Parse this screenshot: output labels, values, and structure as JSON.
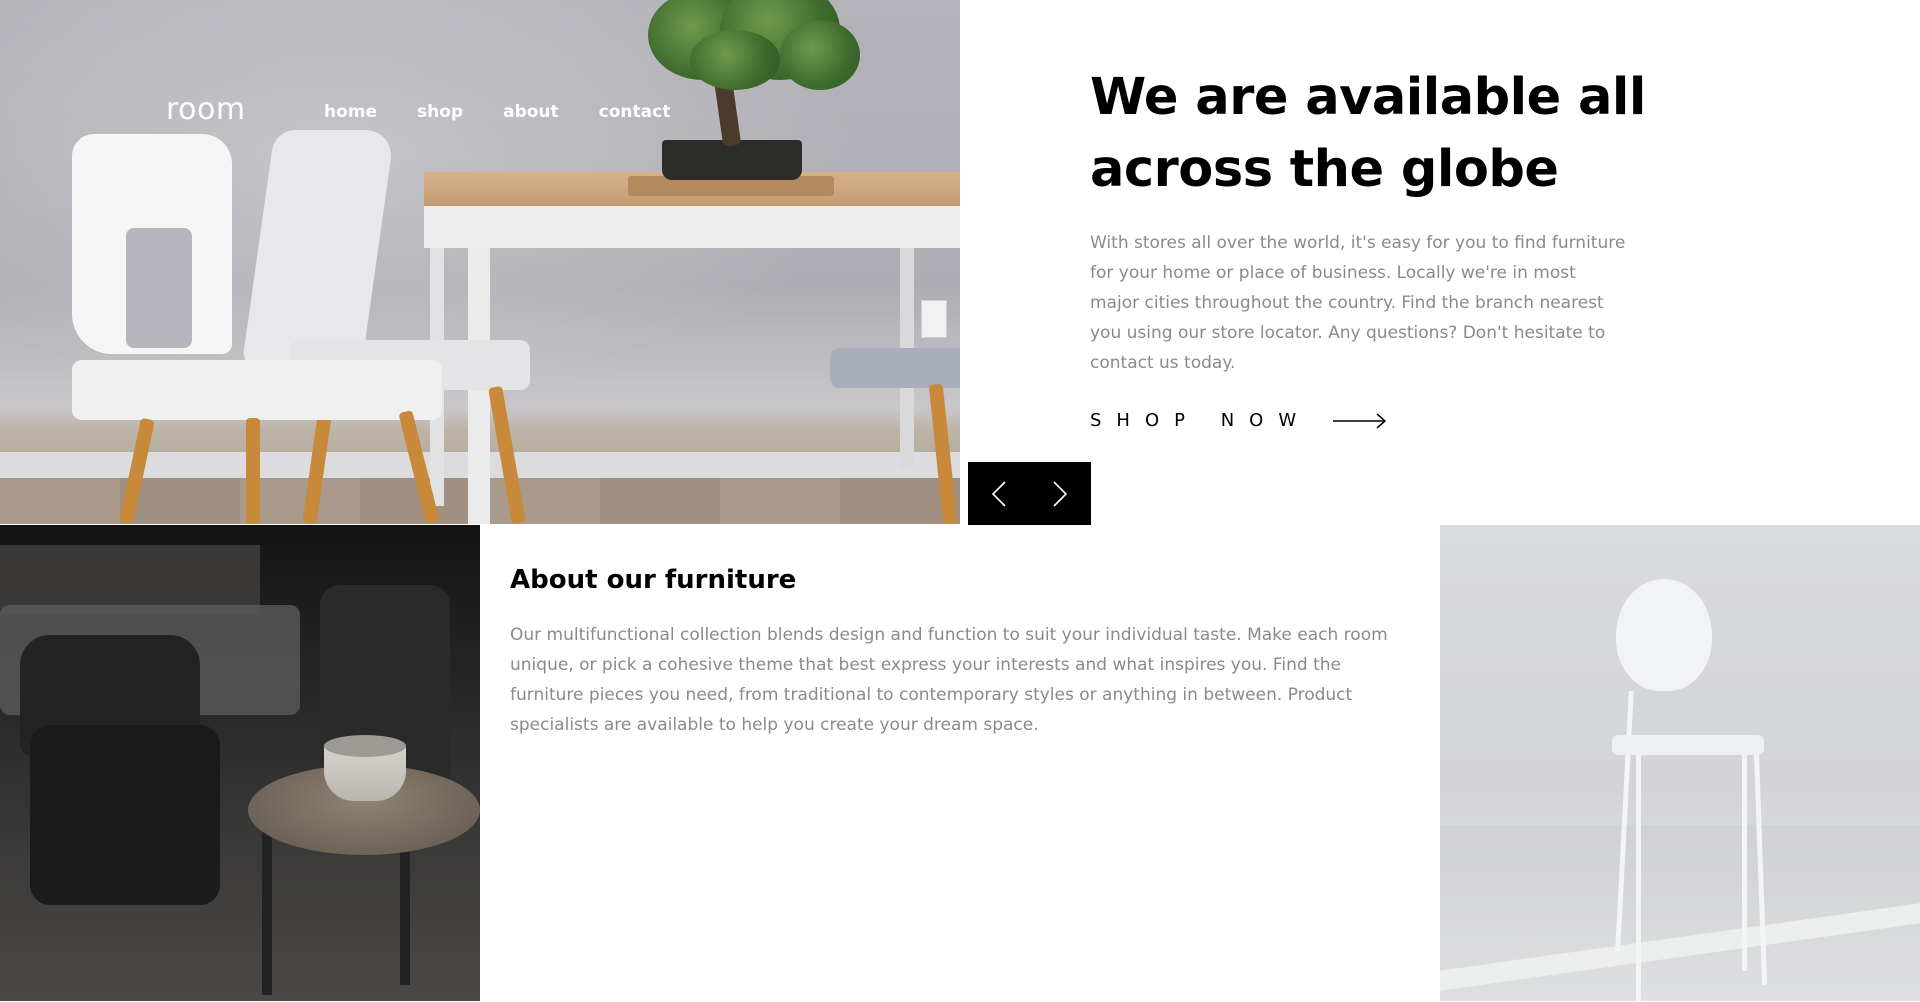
{
  "nav": {
    "logo": "room",
    "links": [
      {
        "label": "home"
      },
      {
        "label": "shop"
      },
      {
        "label": "about"
      },
      {
        "label": "contact"
      }
    ]
  },
  "hero": {
    "title_line1": "We are available all",
    "title_line2": "across the globe",
    "description": "With stores all over the world, it's easy for you to find furniture for your home or place of business. Locally we're in most major cities throughout the country. Find the branch nearest you using our store locator. Any questions? Don't hesitate to contact us today.",
    "cta_label": "SHOP NOW",
    "cta_icon": "arrow-right-icon"
  },
  "slider": {
    "prev_icon": "chevron-left-icon",
    "next_icon": "chevron-right-icon"
  },
  "about": {
    "title": "About our furniture",
    "text": "Our multifunctional collection blends design and function to suit your individual taste. Make each room unique, or pick a cohesive theme that best express your interests and what inspires you. Find the furniture pieces you need, from traditional to contemporary styles or anything in between. Product specialists are available to help you create your dream space."
  },
  "colors": {
    "text_dark": "#000000",
    "text_muted": "#8a8a8a",
    "background": "#ffffff",
    "slider_bg": "#000000"
  }
}
